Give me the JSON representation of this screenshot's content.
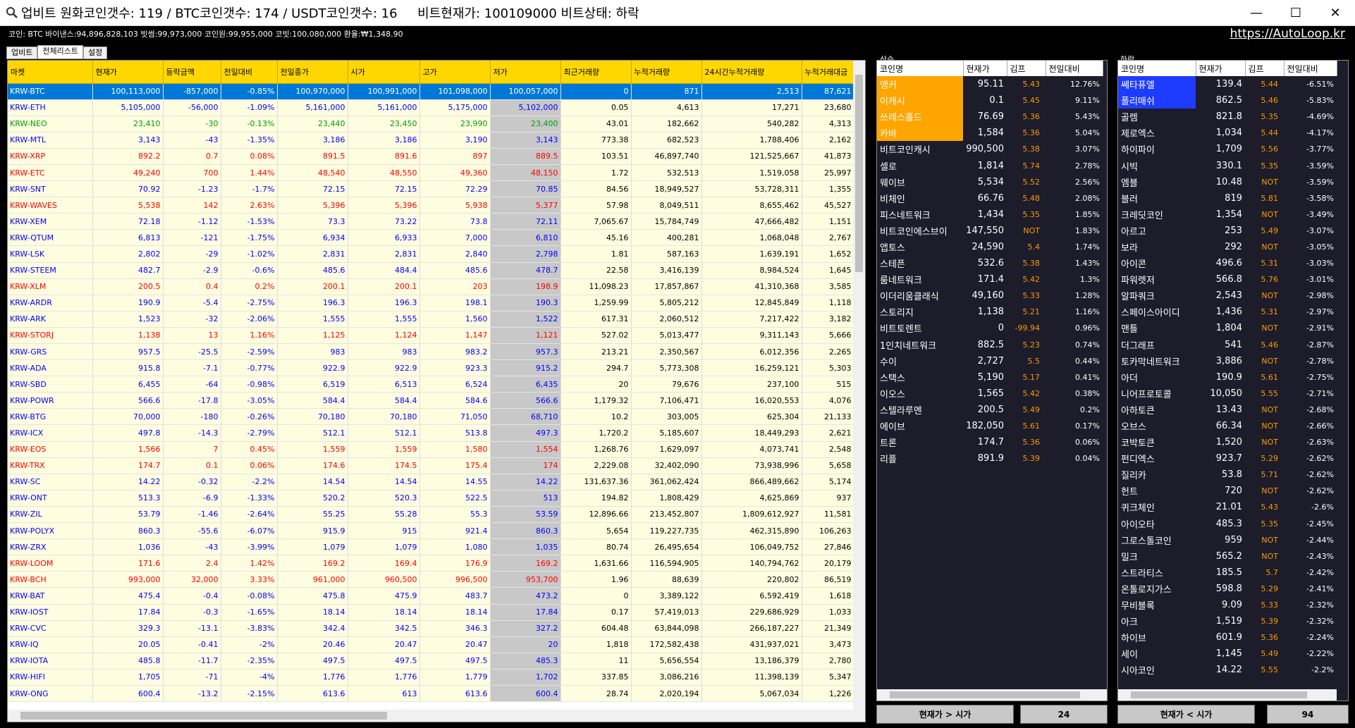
{
  "window": {
    "title": "업비트 원화코인갯수: 119 / BTC코인갯수: 174 / USDT코인갯수: 16     비트현재가: 100109000 비트상태: 하락",
    "minimize": "—",
    "maximize": "☐",
    "close": "✕"
  },
  "infobar": {
    "text": "코인: BTC   바이낸스:94,896,828,103  빗썸:99,973,000   코인원:99,955,000   코빗:100,080,000   환율:₩1,348.90",
    "link": "https://AutoLoop.kr"
  },
  "tabs": [
    "업비트",
    "전체리스트",
    "설정"
  ],
  "market_table": {
    "headers": [
      "마켓",
      "현재가",
      "등락금액",
      "전일대비",
      "전일종가",
      "시가",
      "고가",
      "저가",
      "최근거래량",
      "누적거래량",
      "24시간누적거래량",
      "누적거래대금"
    ],
    "rows": [
      [
        "KRW-BTC",
        "100,113,000",
        "-857,000",
        "-0.85%",
        "100,970,000",
        "100,991,000",
        "101,098,000",
        "100,057,000",
        "0",
        "871",
        "2,513",
        "87,621",
        "b",
        1
      ],
      [
        "KRW-ETH",
        "5,105,000",
        "-56,000",
        "-1.09%",
        "5,161,000",
        "5,161,000",
        "5,175,000",
        "5,102,000",
        "0.05",
        "4,613",
        "17,271",
        "23,680",
        "b",
        0
      ],
      [
        "KRW-NEO",
        "23,410",
        "-30",
        "-0.13%",
        "23,440",
        "23,450",
        "23,990",
        "23,400",
        "43.01",
        "182,662",
        "540,282",
        "4,313",
        "g",
        0
      ],
      [
        "KRW-MTL",
        "3,143",
        "-43",
        "-1.35%",
        "3,186",
        "3,186",
        "3,190",
        "3,143",
        "773.38",
        "682,523",
        "1,788,406",
        "2,162",
        "b",
        0
      ],
      [
        "KRW-XRP",
        "892.2",
        "0.7",
        "0.08%",
        "891.5",
        "891.6",
        "897",
        "889.5",
        "103.51",
        "46,897,740",
        "121,525,667",
        "41,873",
        "r",
        0
      ],
      [
        "KRW-ETC",
        "49,240",
        "700",
        "1.44%",
        "48,540",
        "48,550",
        "49,360",
        "48,150",
        "1.72",
        "532,513",
        "1,519,058",
        "25,997",
        "r",
        0
      ],
      [
        "KRW-SNT",
        "70.92",
        "-1.23",
        "-1.7%",
        "72.15",
        "72.15",
        "72.29",
        "70.85",
        "84.56",
        "18,949,527",
        "53,728,311",
        "1,355",
        "b",
        0
      ],
      [
        "KRW-WAVES",
        "5,538",
        "142",
        "2.63%",
        "5,396",
        "5,396",
        "5,938",
        "5,377",
        "57.98",
        "8,049,511",
        "8,655,462",
        "45,527",
        "r",
        0
      ],
      [
        "KRW-XEM",
        "72.18",
        "-1.12",
        "-1.53%",
        "73.3",
        "73.22",
        "73.8",
        "72.11",
        "7,065.67",
        "15,784,749",
        "47,666,482",
        "1,151",
        "b",
        0
      ],
      [
        "KRW-QTUM",
        "6,813",
        "-121",
        "-1.75%",
        "6,934",
        "6,933",
        "7,000",
        "6,810",
        "45.16",
        "400,281",
        "1,068,048",
        "2,767",
        "b",
        0
      ],
      [
        "KRW-LSK",
        "2,802",
        "-29",
        "-1.02%",
        "2,831",
        "2,831",
        "2,840",
        "2,798",
        "1.81",
        "587,163",
        "1,639,191",
        "1,652",
        "b",
        0
      ],
      [
        "KRW-STEEM",
        "482.7",
        "-2.9",
        "-0.6%",
        "485.6",
        "484.4",
        "485.6",
        "478.7",
        "22.58",
        "3,416,139",
        "8,984,524",
        "1,645",
        "b",
        0
      ],
      [
        "KRW-XLM",
        "200.5",
        "0.4",
        "0.2%",
        "200.1",
        "200.1",
        "203",
        "198.9",
        "11,098.23",
        "17,857,867",
        "41,310,368",
        "3,585",
        "r",
        0
      ],
      [
        "KRW-ARDR",
        "190.9",
        "-5.4",
        "-2.75%",
        "196.3",
        "196.3",
        "198.1",
        "190.3",
        "1,259.99",
        "5,805,212",
        "12,845,849",
        "1,118",
        "b",
        0
      ],
      [
        "KRW-ARK",
        "1,523",
        "-32",
        "-2.06%",
        "1,555",
        "1,555",
        "1,560",
        "1,522",
        "617.31",
        "2,060,512",
        "7,217,422",
        "3,182",
        "b",
        0
      ],
      [
        "KRW-STORJ",
        "1,138",
        "13",
        "1.16%",
        "1,125",
        "1,124",
        "1,147",
        "1,121",
        "527.02",
        "5,013,477",
        "9,311,143",
        "5,666",
        "r",
        0
      ],
      [
        "KRW-GRS",
        "957.5",
        "-25.5",
        "-2.59%",
        "983",
        "983",
        "983.2",
        "957.3",
        "213.21",
        "2,350,567",
        "6,012,356",
        "2,265",
        "b",
        0
      ],
      [
        "KRW-ADA",
        "915.8",
        "-7.1",
        "-0.77%",
        "922.9",
        "922.9",
        "923.3",
        "915.2",
        "294.7",
        "5,773,308",
        "16,259,121",
        "5,303",
        "b",
        0
      ],
      [
        "KRW-SBD",
        "6,455",
        "-64",
        "-0.98%",
        "6,519",
        "6,513",
        "6,524",
        "6,435",
        "20",
        "79,676",
        "237,100",
        "515",
        "b",
        0
      ],
      [
        "KRW-POWR",
        "566.6",
        "-17.8",
        "-3.05%",
        "584.4",
        "584.4",
        "584.6",
        "566.6",
        "1,179.32",
        "7,106,471",
        "16,020,553",
        "4,076",
        "b",
        0
      ],
      [
        "KRW-BTG",
        "70,000",
        "-180",
        "-0.26%",
        "70,180",
        "70,180",
        "71,050",
        "68,710",
        "10.2",
        "303,005",
        "625,304",
        "21,133",
        "b",
        0
      ],
      [
        "KRW-ICX",
        "497.8",
        "-14.3",
        "-2.79%",
        "512.1",
        "512.1",
        "513.8",
        "497.3",
        "1,720.2",
        "5,185,607",
        "18,449,293",
        "2,621",
        "b",
        0
      ],
      [
        "KRW-EOS",
        "1,566",
        "7",
        "0.45%",
        "1,559",
        "1,559",
        "1,580",
        "1,554",
        "1,268.76",
        "1,629,097",
        "4,073,741",
        "2,548",
        "r",
        0
      ],
      [
        "KRW-TRX",
        "174.7",
        "0.1",
        "0.06%",
        "174.6",
        "174.5",
        "175.4",
        "174",
        "2,229.08",
        "32,402,090",
        "73,938,996",
        "5,658",
        "r",
        0
      ],
      [
        "KRW-SC",
        "14.22",
        "-0.32",
        "-2.2%",
        "14.54",
        "14.54",
        "14.55",
        "14.22",
        "131,637.36",
        "361,062,424",
        "866,489,662",
        "5,174",
        "b",
        0
      ],
      [
        "KRW-ONT",
        "513.3",
        "-6.9",
        "-1.33%",
        "520.2",
        "520.3",
        "522.5",
        "513",
        "194.82",
        "1,808,429",
        "4,625,869",
        "937",
        "b",
        0
      ],
      [
        "KRW-ZIL",
        "53.79",
        "-1.46",
        "-2.64%",
        "55.25",
        "55.28",
        "55.3",
        "53.59",
        "12,896.66",
        "213,452,807",
        "1,809,612,927",
        "11,581",
        "b",
        0
      ],
      [
        "KRW-POLYX",
        "860.3",
        "-55.6",
        "-6.07%",
        "915.9",
        "915",
        "921.4",
        "860.3",
        "5,654",
        "119,227,735",
        "462,315,890",
        "106,263",
        "b",
        0
      ],
      [
        "KRW-ZRX",
        "1,036",
        "-43",
        "-3.99%",
        "1,079",
        "1,079",
        "1,080",
        "1,035",
        "80.74",
        "26,495,654",
        "106,049,752",
        "27,846",
        "b",
        0
      ],
      [
        "KRW-LOOM",
        "171.6",
        "2.4",
        "1.42%",
        "169.2",
        "169.4",
        "176.9",
        "169.2",
        "1,631.66",
        "116,594,905",
        "140,794,762",
        "20,179",
        "r",
        0
      ],
      [
        "KRW-BCH",
        "993,000",
        "32,000",
        "3.33%",
        "961,000",
        "960,500",
        "996,500",
        "953,700",
        "1.96",
        "88,639",
        "220,802",
        "86,519",
        "r",
        0
      ],
      [
        "KRW-BAT",
        "475.4",
        "-0.4",
        "-0.08%",
        "475.8",
        "475.9",
        "483.7",
        "473.2",
        "0",
        "3,389,122",
        "6,592,419",
        "1,618",
        "b",
        0
      ],
      [
        "KRW-IOST",
        "17.84",
        "-0.3",
        "-1.65%",
        "18.14",
        "18.14",
        "18.14",
        "17.84",
        "0.17",
        "57,419,013",
        "229,686,929",
        "1,033",
        "b",
        0
      ],
      [
        "KRW-CVC",
        "329.3",
        "-13.1",
        "-3.83%",
        "342.4",
        "342.5",
        "346.3",
        "327.2",
        "604.48",
        "63,844,098",
        "266,187,227",
        "21,349",
        "b",
        0
      ],
      [
        "KRW-IQ",
        "20.05",
        "-0.41",
        "-2%",
        "20.46",
        "20.47",
        "20.47",
        "20",
        "1,818",
        "172,582,438",
        "431,937,021",
        "3,473",
        "b",
        0
      ],
      [
        "KRW-IOTA",
        "485.8",
        "-11.7",
        "-2.35%",
        "497.5",
        "497.5",
        "497.5",
        "485.3",
        "11",
        "5,656,554",
        "13,186,379",
        "2,780",
        "b",
        0
      ],
      [
        "KRW-HIFI",
        "1,705",
        "-71",
        "-4%",
        "1,776",
        "1,776",
        "1,779",
        "1,702",
        "337.85",
        "3,086,216",
        "11,398,139",
        "5,347",
        "b",
        0
      ],
      [
        "KRW-ONG",
        "600.4",
        "-13.2",
        "-2.15%",
        "613.6",
        "613",
        "613.6",
        "600.4",
        "28.74",
        "2,020,194",
        "5,067,034",
        "1,226",
        "b",
        0
      ]
    ]
  },
  "rise_panel": {
    "label": "상승",
    "headers": [
      "코인명",
      "현재가",
      "김프",
      "전일대비"
    ],
    "rows": [
      [
        "앵커",
        "95.11",
        "5.43",
        "12.76%",
        "o"
      ],
      [
        "이캐시",
        "0.1",
        "5.45",
        "9.11%",
        "o"
      ],
      [
        "쓰레스홀드",
        "76.69",
        "5.36",
        "5.43%",
        "o"
      ],
      [
        "카바",
        "1,584",
        "5.36",
        "5.04%",
        "o"
      ],
      [
        "비트코인캐시",
        "990,500",
        "5.38",
        "3.07%",
        ""
      ],
      [
        "셀로",
        "1,814",
        "5.74",
        "2.78%",
        ""
      ],
      [
        "웨이브",
        "5,534",
        "5.52",
        "2.56%",
        ""
      ],
      [
        "비체인",
        "66.76",
        "5.48",
        "2.08%",
        ""
      ],
      [
        "피스네트워크",
        "1,434",
        "5.35",
        "1.85%",
        ""
      ],
      [
        "비트코인에스브이",
        "147,550",
        "NOT",
        "1.83%",
        ""
      ],
      [
        "앱토스",
        "24,590",
        "5.4",
        "1.74%",
        ""
      ],
      [
        "스테픈",
        "532.6",
        "5.38",
        "1.43%",
        ""
      ],
      [
        "룸네트워크",
        "171.4",
        "5.42",
        "1.3%",
        ""
      ],
      [
        "이더리움클래식",
        "49,160",
        "5.33",
        "1.28%",
        ""
      ],
      [
        "스토리지",
        "1,138",
        "5.21",
        "1.16%",
        ""
      ],
      [
        "비트토렌트",
        "0",
        "-99.94",
        "0.96%",
        ""
      ],
      [
        "1인치네트워크",
        "882.5",
        "5.23",
        "0.74%",
        ""
      ],
      [
        "수이",
        "2,727",
        "5.5",
        "0.44%",
        ""
      ],
      [
        "스택스",
        "5,190",
        "5.17",
        "0.41%",
        ""
      ],
      [
        "이오스",
        "1,565",
        "5.42",
        "0.38%",
        ""
      ],
      [
        "스텔라루멘",
        "200.5",
        "5.49",
        "0.2%",
        ""
      ],
      [
        "에이브",
        "182,050",
        "5.61",
        "0.17%",
        ""
      ],
      [
        "트론",
        "174.7",
        "5.36",
        "0.06%",
        ""
      ],
      [
        "리플",
        "891.9",
        "5.39",
        "0.04%",
        ""
      ]
    ],
    "button": "현재가 > 시가",
    "count": "24"
  },
  "fall_panel": {
    "label": "하락",
    "headers": [
      "코인명",
      "현재가",
      "김프",
      "전일대비"
    ],
    "rows": [
      [
        "쎄타퓨엘",
        "139.4",
        "5.44",
        "-6.51%",
        "b"
      ],
      [
        "폴리매쉬",
        "862.5",
        "5.46",
        "-5.83%",
        "b"
      ],
      [
        "골렘",
        "821.8",
        "5.35",
        "-4.69%",
        ""
      ],
      [
        "제로엑스",
        "1,034",
        "5.44",
        "-4.17%",
        ""
      ],
      [
        "하이파이",
        "1,709",
        "5.56",
        "-3.77%",
        ""
      ],
      [
        "시빅",
        "330.1",
        "5.35",
        "-3.59%",
        ""
      ],
      [
        "엠블",
        "10.48",
        "NOT",
        "-3.59%",
        ""
      ],
      [
        "블러",
        "819",
        "5.81",
        "-3.58%",
        ""
      ],
      [
        "크레딧코인",
        "1,354",
        "NOT",
        "-3.49%",
        ""
      ],
      [
        "아르고",
        "253",
        "5.49",
        "-3.07%",
        ""
      ],
      [
        "보라",
        "292",
        "NOT",
        "-3.05%",
        ""
      ],
      [
        "아이콘",
        "496.6",
        "5.31",
        "-3.03%",
        ""
      ],
      [
        "파워렛저",
        "566.8",
        "5.76",
        "-3.01%",
        ""
      ],
      [
        "알파쿼크",
        "2,543",
        "NOT",
        "-2.98%",
        ""
      ],
      [
        "스페이스아이디",
        "1,436",
        "5.31",
        "-2.97%",
        ""
      ],
      [
        "맨틀",
        "1,804",
        "NOT",
        "-2.91%",
        ""
      ],
      [
        "더그래프",
        "541",
        "5.46",
        "-2.87%",
        ""
      ],
      [
        "토카막네트워크",
        "3,886",
        "NOT",
        "-2.78%",
        ""
      ],
      [
        "아더",
        "190.9",
        "5.61",
        "-2.75%",
        ""
      ],
      [
        "니어프로토콜",
        "10,050",
        "5.55",
        "-2.71%",
        ""
      ],
      [
        "아하토큰",
        "13.43",
        "NOT",
        "-2.68%",
        ""
      ],
      [
        "오브스",
        "66.34",
        "NOT",
        "-2.66%",
        ""
      ],
      [
        "코박토큰",
        "1,520",
        "NOT",
        "-2.63%",
        ""
      ],
      [
        "펀디엑스",
        "923.7",
        "5.29",
        "-2.62%",
        ""
      ],
      [
        "질리카",
        "53.8",
        "5.71",
        "-2.62%",
        ""
      ],
      [
        "헌트",
        "720",
        "NOT",
        "-2.62%",
        ""
      ],
      [
        "퀴크체인",
        "21.01",
        "5.43",
        "-2.6%",
        ""
      ],
      [
        "아이오타",
        "485.3",
        "5.35",
        "-2.45%",
        ""
      ],
      [
        "그로스톨코인",
        "959",
        "NOT",
        "-2.44%",
        ""
      ],
      [
        "밀크",
        "565.2",
        "NOT",
        "-2.43%",
        ""
      ],
      [
        "스트라티스",
        "185.5",
        "5.7",
        "-2.42%",
        ""
      ],
      [
        "온톨로지가스",
        "598.8",
        "5.29",
        "-2.41%",
        ""
      ],
      [
        "무비블록",
        "9.09",
        "5.33",
        "-2.32%",
        ""
      ],
      [
        "아크",
        "1,519",
        "5.39",
        "-2.32%",
        ""
      ],
      [
        "하이브",
        "601.9",
        "5.36",
        "-2.24%",
        ""
      ],
      [
        "세이",
        "1,145",
        "5.49",
        "-2.22%",
        ""
      ],
      [
        "시아코인",
        "14.22",
        "5.55",
        "-2.2%",
        ""
      ]
    ],
    "button": "현재가 < 시가",
    "count": "94"
  }
}
